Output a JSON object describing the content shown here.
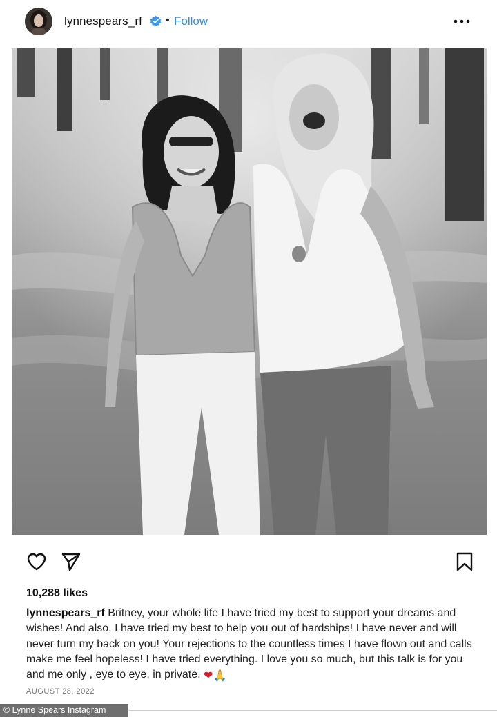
{
  "header": {
    "username": "lynnespears_rf",
    "separator": "•",
    "follow_label": "Follow",
    "avatar_icon": "profile-photo",
    "verified_icon": "verified-badge-icon",
    "more_icon": "more-options-icon"
  },
  "post": {
    "likes": "10,288 likes",
    "caption_user": "lynnespears_rf",
    "caption_text": "Britney, your whole life I have tried my best to support your dreams and wishes! And also, I have tried my best to help you out of hardships! I have never and will never turn my back on you! Your rejections to the countless times I have flown out and calls make me feel hopeless! I have tried everything. I love you so much, but this talk is for you and me only , eye to eye, in private.",
    "caption_emojis": "❤🙏",
    "date": "AUGUST 28, 2022"
  },
  "actions": {
    "like_icon": "heart-icon",
    "share_icon": "paper-plane-icon",
    "save_icon": "bookmark-icon"
  },
  "credit": "© Lynne Spears Instagram",
  "colors": {
    "accent": "#2f8fe6",
    "text": "#111111",
    "muted": "#7a7a7a"
  }
}
